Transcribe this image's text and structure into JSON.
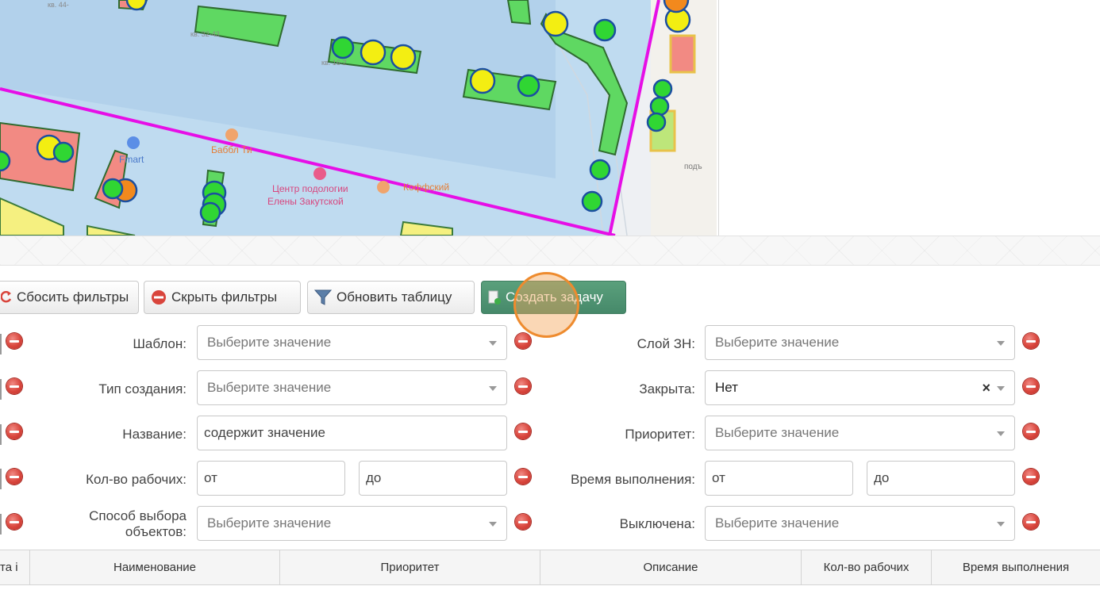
{
  "map": {
    "labels": {
      "store": "Fmart",
      "cafe": "Баббл Ти",
      "clinic_line1": "Центр подологии",
      "clinic_line2": "Елены Закутской",
      "coffee": "Коффский",
      "podezd": "подъ",
      "apt1": "кв. 44-",
      "apt2": "кв. 32-43",
      "apt3": "кв. 16-2"
    },
    "colors": {
      "boundary": "#e60fe6",
      "zone_fill": "#bcd9ef",
      "building_green": "#5fd862",
      "building_red": "#f28a83",
      "marker_yellow": "#f3ee12",
      "marker_green": "#30d633",
      "marker_orange": "#f2891d"
    }
  },
  "toolbar": {
    "reset_filters": "Сбосить фильтры",
    "hide_filters": "Скрыть фильтры",
    "refresh_table": "Обновить таблицу",
    "create_task": "Создать задачу"
  },
  "filters": {
    "template": {
      "label": "Шаблон:",
      "placeholder": "Выберите значение"
    },
    "creation_type": {
      "label": "Тип создания:",
      "placeholder": "Выберите значение"
    },
    "name": {
      "label": "Название:",
      "placeholder": "содержит значение"
    },
    "workers": {
      "label": "Кол-во рабочих:",
      "from": "от",
      "to": "до"
    },
    "object_selection": {
      "label_line1": "Способ выбора",
      "label_line2": "объектов:",
      "placeholder": "Выберите значение"
    },
    "layer": {
      "label": "Слой ЗН:",
      "placeholder": "Выберите значение"
    },
    "closed": {
      "label": "Закрыта:",
      "value": "Нет",
      "clear": "×"
    },
    "priority": {
      "label": "Приоритет:",
      "placeholder": "Выберите значение"
    },
    "duration": {
      "label": "Время выполнения:",
      "from": "от",
      "to": "до"
    },
    "disabled": {
      "label": "Выключена:",
      "placeholder": "Выберите значение"
    }
  },
  "table": {
    "columns": [
      "та і",
      "Наименование",
      "Приоритет",
      "Описание",
      "Кол-во рабочих",
      "Время выполнения"
    ]
  }
}
